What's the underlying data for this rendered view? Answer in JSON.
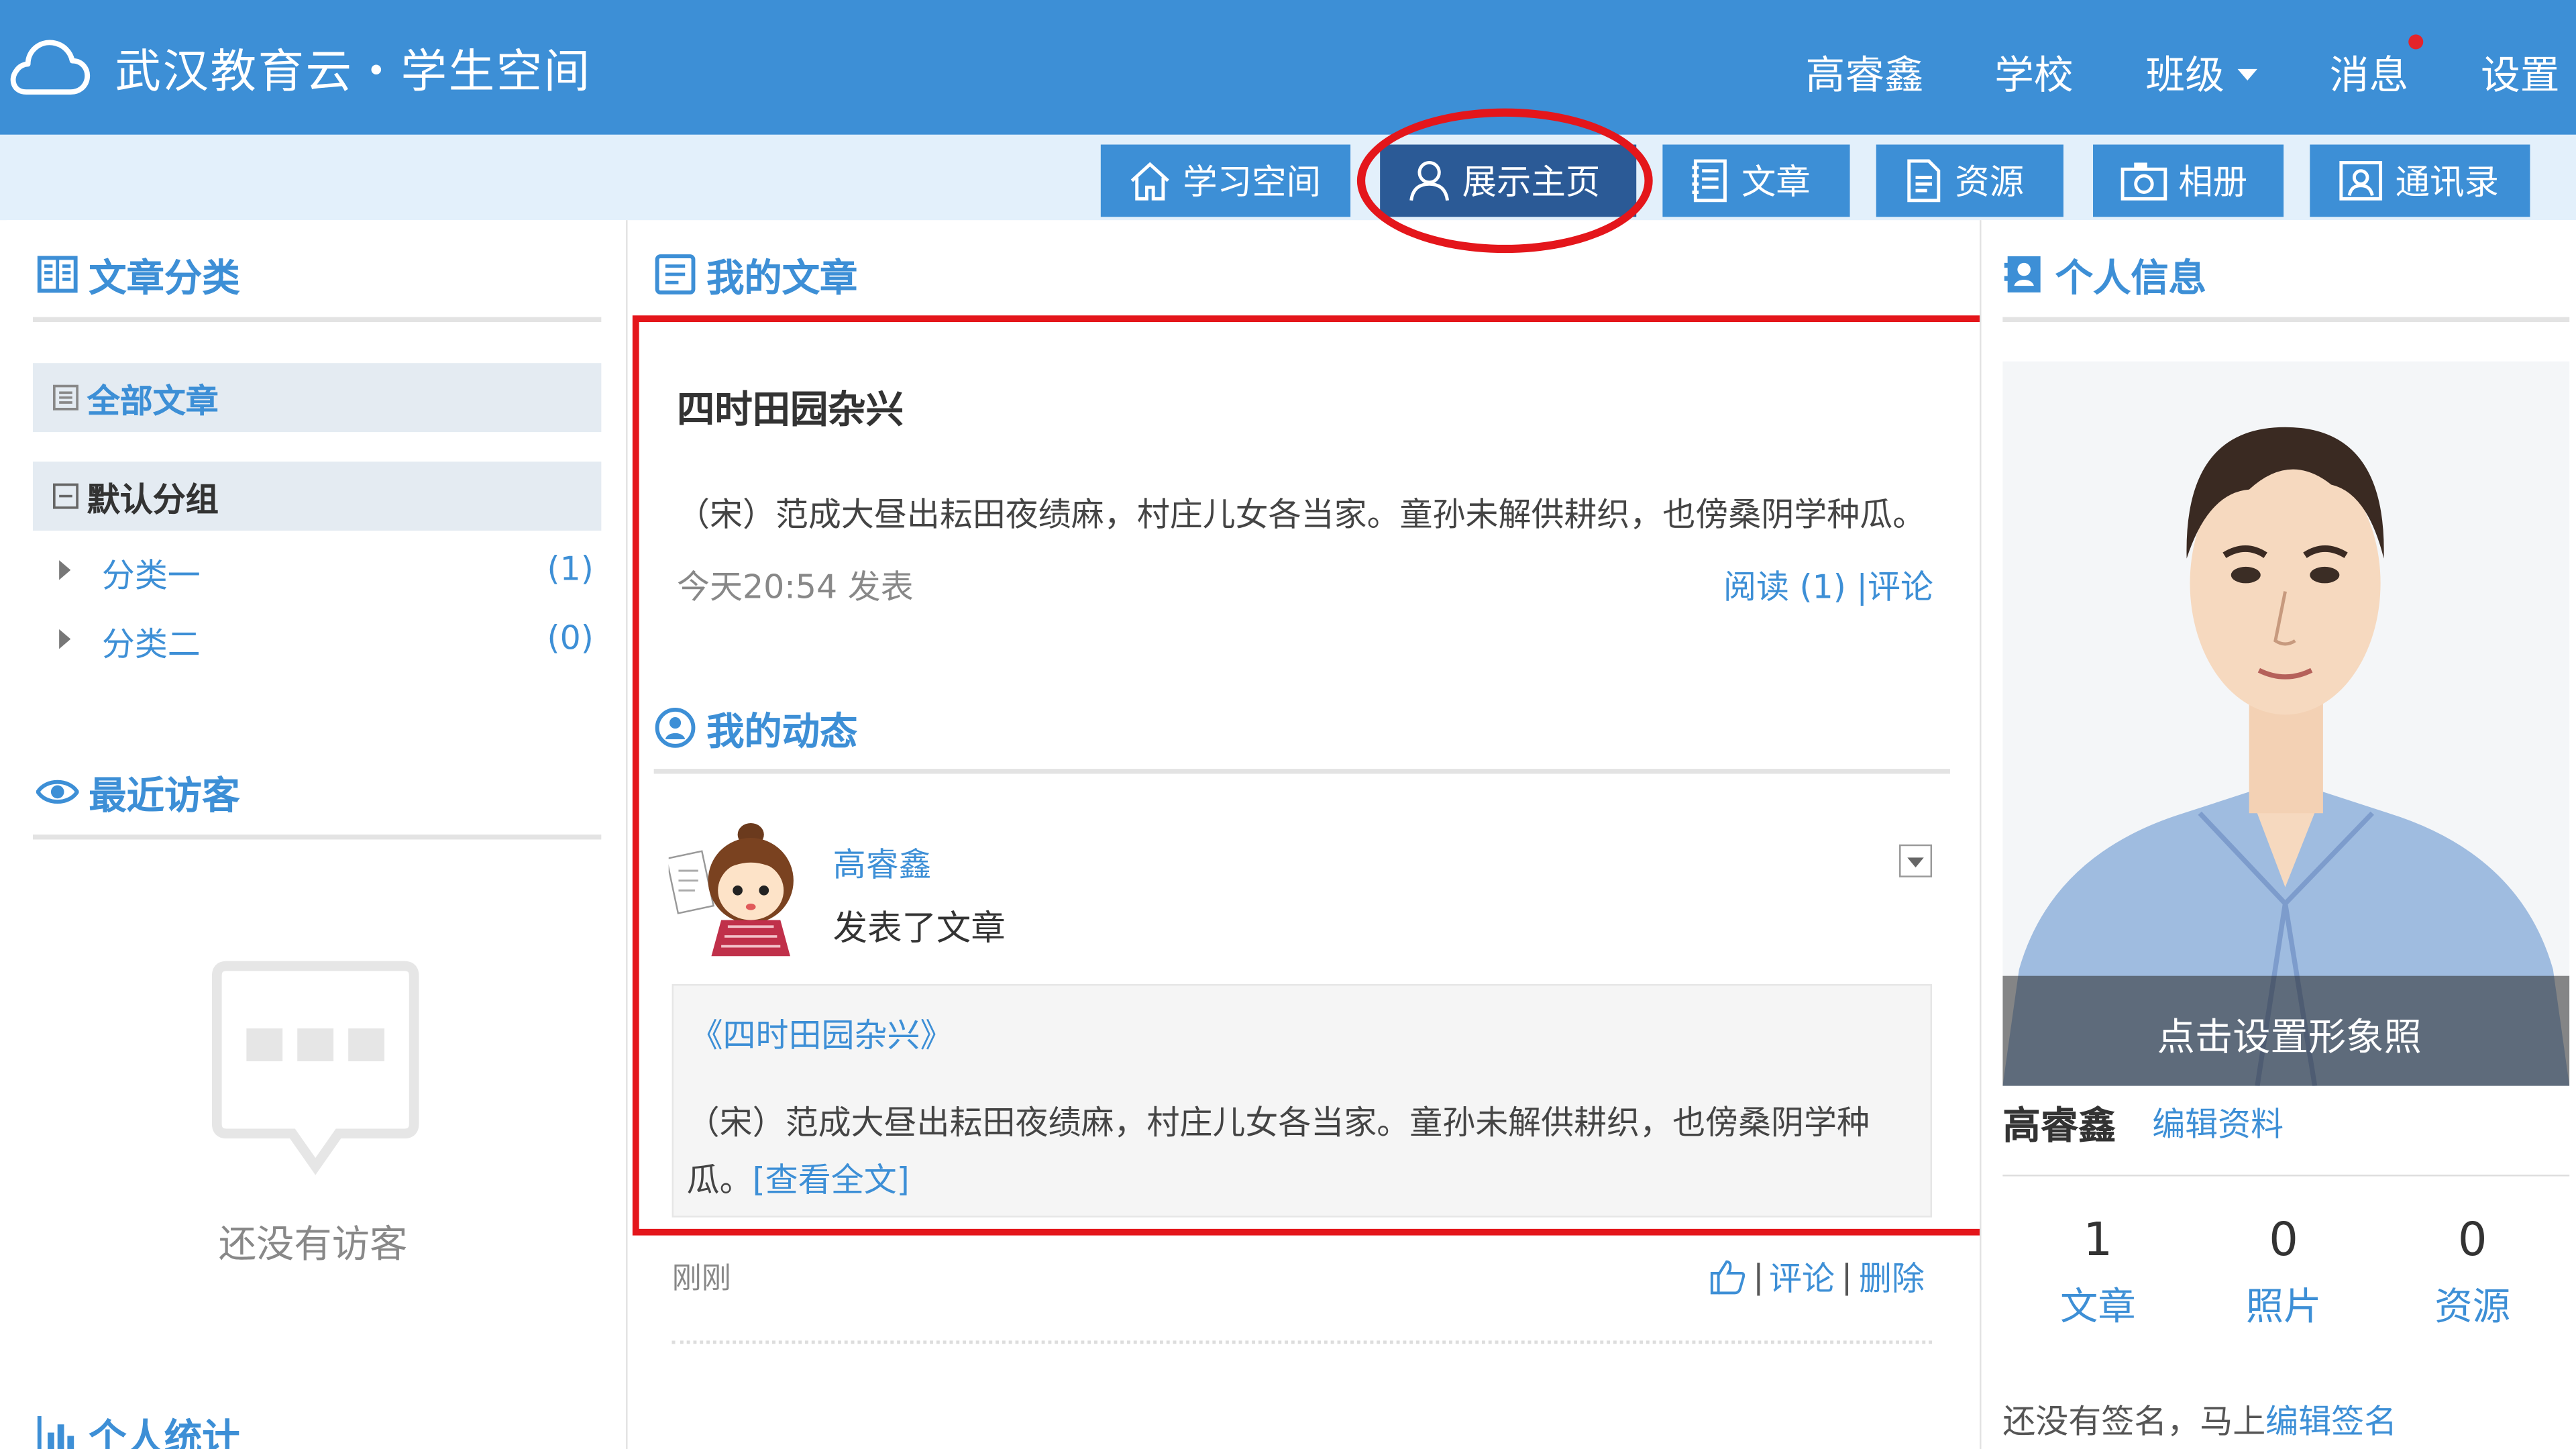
{
  "header": {
    "site_title": "武汉教育云・学生空间",
    "nav": {
      "user": "高睿鑫",
      "school": "学校",
      "class": "班级",
      "messages": "消息",
      "settings": "设置"
    }
  },
  "tabs": [
    {
      "label": "学习空间"
    },
    {
      "label": "展示主页"
    },
    {
      "label": "文章"
    },
    {
      "label": "资源"
    },
    {
      "label": "相册"
    },
    {
      "label": "通讯录"
    }
  ],
  "left": {
    "category_title": "文章分类",
    "all_articles": "全部文章",
    "default_group": "默认分组",
    "subcategories": [
      {
        "label": "分类一",
        "count": "(1)"
      },
      {
        "label": "分类二",
        "count": "(0)"
      }
    ],
    "visitors_title": "最近访客",
    "no_visitors": "还没有访客",
    "stats_title": "个人统计"
  },
  "main": {
    "title": "我的文章",
    "article": {
      "title": "四时田园杂兴",
      "excerpt": "（宋）范成大昼出耘田夜绩麻，村庄儿女各当家。童孙未解供耕织，也傍桑阴学种瓜。",
      "time": "今天20:54 发表",
      "read": "阅读 (1)",
      "sep": "|",
      "comment": "评论"
    },
    "activity_title": "我的动态",
    "feed": {
      "user": "高睿鑫",
      "action": "发表了文章",
      "linked_title": "《四时田园杂兴》",
      "excerpt": "（宋）范成大昼出耘田夜绩麻，村庄儿女各当家。童孙未解供耕织，也傍桑阴学种",
      "excerpt_tail": "瓜。",
      "view_full": "[查看全文]",
      "time": "刚刚",
      "comment": "评论",
      "delete": "删除",
      "sep": "|"
    }
  },
  "right": {
    "title": "个人信息",
    "set_photo": "点击设置形象照",
    "name": "高睿鑫",
    "edit_profile": "编辑资料",
    "stats": [
      {
        "num": "1",
        "label": "文章"
      },
      {
        "num": "0",
        "label": "照片"
      },
      {
        "num": "0",
        "label": "资源"
      }
    ],
    "signature_prefix": "还没有签名，马上",
    "edit_signature": "编辑签名"
  },
  "colors": {
    "primary": "#3d8fd6",
    "active_tab": "#2b5a96",
    "highlight": "#e4161b",
    "notification": "#e4242b"
  },
  "icons": [
    "cloud-icon",
    "home-icon",
    "user-icon",
    "article-icon",
    "resource-icon",
    "camera-icon",
    "contacts-icon",
    "book-icon",
    "eye-icon",
    "chart-icon",
    "dynamic-icon",
    "id-card-icon",
    "like-icon",
    "dropdown-icon",
    "chat-bubble-icon"
  ]
}
